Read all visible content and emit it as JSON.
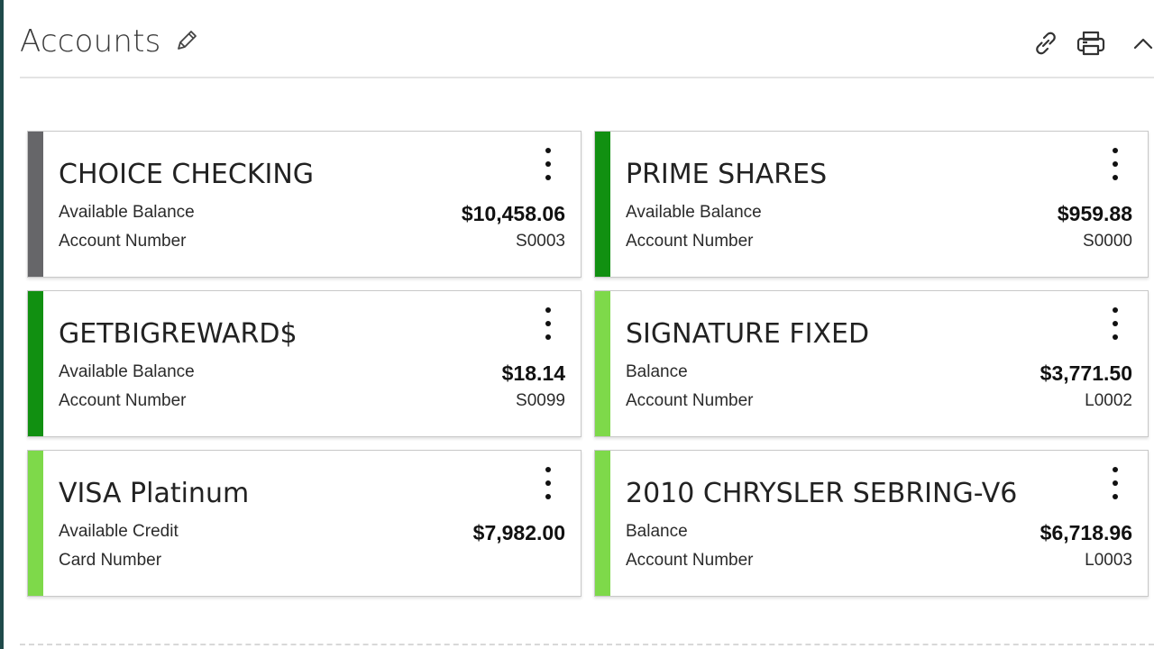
{
  "header": {
    "title": "Accounts"
  },
  "colors": {
    "gray": "#666669",
    "dark_green": "#119011",
    "light_green": "#7ed94a"
  },
  "accounts": [
    {
      "name": "CHOICE CHECKING",
      "label1": "Available Balance",
      "amount": "$10,458.06",
      "label2": "Account Number",
      "number": "S0003",
      "color": "#666669"
    },
    {
      "name": "PRIME SHARES",
      "label1": "Available Balance",
      "amount": "$959.88",
      "label2": "Account Number",
      "number": "S0000",
      "color": "#119011"
    },
    {
      "name": "GETBIGREWARD$",
      "label1": "Available Balance",
      "amount": "$18.14",
      "label2": "Account Number",
      "number": "S0099",
      "color": "#119011"
    },
    {
      "name": "SIGNATURE FIXED",
      "label1": "Balance",
      "amount": "$3,771.50",
      "label2": "Account Number",
      "number": "L0002",
      "color": "#7ed94a"
    },
    {
      "name": "VISA Platinum",
      "label1": "Available Credit",
      "amount": "$7,982.00",
      "label2": "Card Number",
      "number": "",
      "color": "#7ed94a"
    },
    {
      "name": "2010 CHRYSLER SEBRING-V6",
      "label1": "Balance",
      "amount": "$6,718.96",
      "label2": "Account Number",
      "number": "L0003",
      "color": "#7ed94a"
    }
  ],
  "icons": {
    "edit": "pencil-icon",
    "link": "link-icon",
    "print": "printer-icon",
    "collapse": "chevron-up-icon",
    "menu": "kebab-menu-icon"
  }
}
